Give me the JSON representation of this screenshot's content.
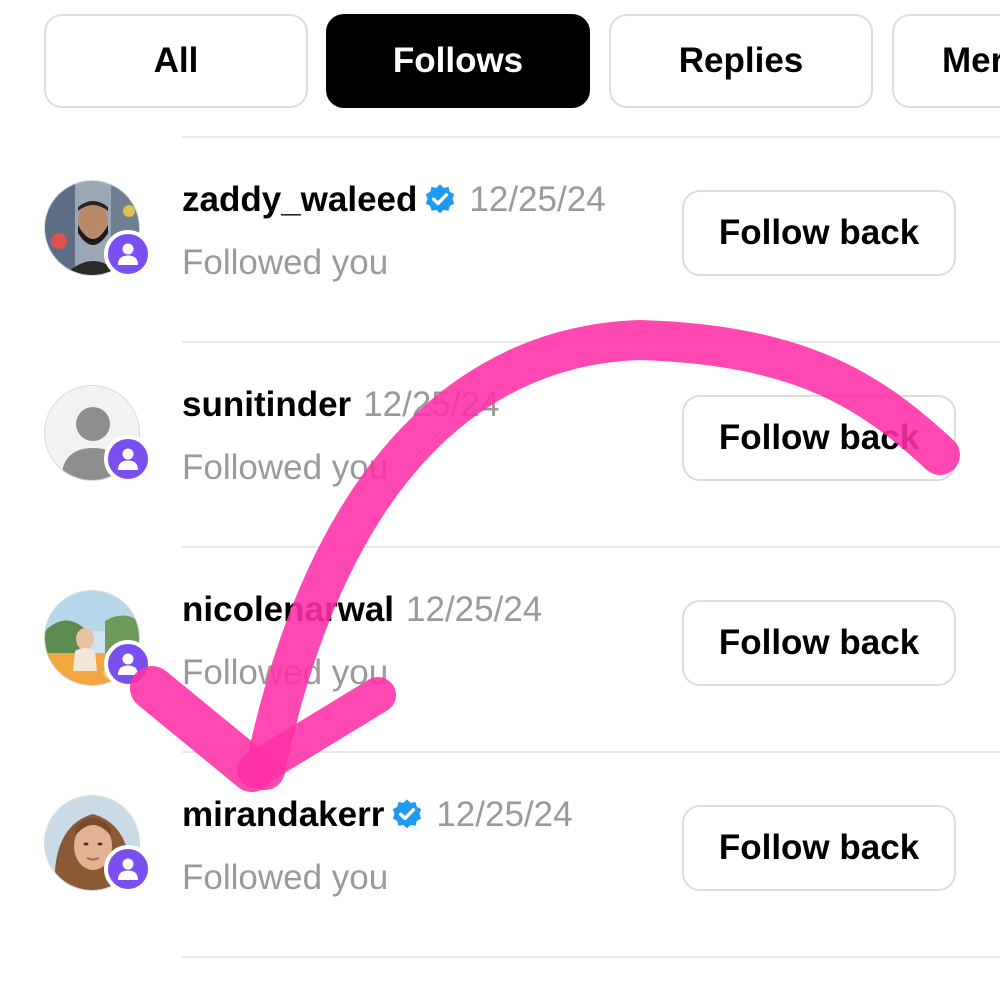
{
  "tabs": [
    {
      "label": "All"
    },
    {
      "label": "Follows"
    },
    {
      "label": "Replies"
    },
    {
      "label": "Mer"
    }
  ],
  "active_tab": "Follows",
  "activity": [
    {
      "username": "zaddy_waleed",
      "verified": true,
      "date": "12/25/24",
      "subtitle": "Followed you",
      "button": "Follow back",
      "avatar": "profile-photo"
    },
    {
      "username": "sunitinder",
      "verified": false,
      "date": "12/25/24",
      "subtitle": "Followed you",
      "button": "Follow back",
      "avatar": "default-avatar"
    },
    {
      "username": "nicolenarwal",
      "verified": false,
      "date": "12/25/24",
      "subtitle": "Followed you",
      "button": "Follow back",
      "avatar": "profile-photo"
    },
    {
      "username": "mirandakerr",
      "verified": true,
      "date": "12/25/24",
      "subtitle": "Followed you",
      "button": "Follow back",
      "avatar": "profile-photo"
    }
  ],
  "colors": {
    "badge": "#7a4ff0",
    "verified": "#1d9bf0",
    "annotation_arrow": "#ff2fa6",
    "muted_text": "#9a9a9a"
  },
  "icons": {
    "badge": "person-icon",
    "verified": "verified-check-icon",
    "annotation": "hand-drawn-arrow"
  }
}
